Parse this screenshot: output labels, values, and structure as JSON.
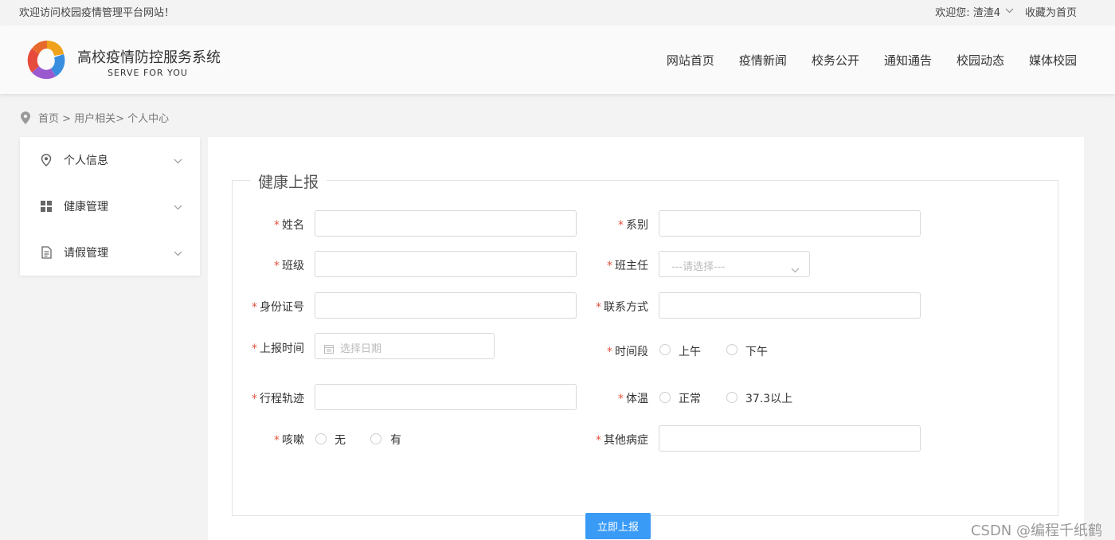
{
  "topbar": {
    "welcome": "欢迎访问校园疫情管理平台网站！",
    "user": "欢迎您: 渣渣4",
    "favorite": "收藏为首页"
  },
  "header": {
    "title": "高校疫情防控服务系统",
    "subtitle": "SERVE FOR YOU",
    "nav": [
      "网站首页",
      "疫情新闻",
      "校务公开",
      "通知通告",
      "校园动态",
      "媒体校园"
    ]
  },
  "breadcrumb": "首页 > 用户相关> 个人中心",
  "sidebar": {
    "items": [
      {
        "label": "个人信息",
        "icon": "location-icon"
      },
      {
        "label": "健康管理",
        "icon": "grid-icon"
      },
      {
        "label": "请假管理",
        "icon": "document-icon"
      }
    ]
  },
  "form": {
    "legend": "健康上报",
    "required_mark": "*",
    "name_label": "姓名",
    "dept_label": "系别",
    "class_label": "班级",
    "teacher_label": "班主任",
    "teacher_placeholder": "---请选择---",
    "id_label": "身份证号",
    "contact_label": "联系方式",
    "time_label": "上报时间",
    "date_placeholder": "选择日期",
    "period_label": "时间段",
    "period_options": [
      "上午",
      "下午"
    ],
    "trip_label": "行程轨迹",
    "temp_label": "体温",
    "temp_options": [
      "正常",
      "37.3以上"
    ],
    "cough_label": "咳嗽",
    "cough_options": [
      "无",
      "有"
    ],
    "other_label": "其他病症",
    "submit": "立即上报"
  },
  "watermark": "CSDN @编程千纸鹤"
}
